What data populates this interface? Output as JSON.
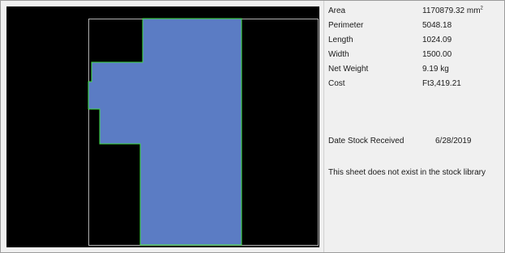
{
  "properties": [
    {
      "label": "Area",
      "value": "1170879.32 mm",
      "sup": "2"
    },
    {
      "label": "Perimeter",
      "value": "5048.18"
    },
    {
      "label": "Length",
      "value": "1024.09"
    },
    {
      "label": "Width",
      "value": "1500.00"
    },
    {
      "label": "Net Weight",
      "value": "9.19 kg"
    },
    {
      "label": "Cost",
      "value": "Ft3,419.21"
    }
  ],
  "stock": {
    "date_label": "Date Stock Received",
    "date_value": "6/28/2019",
    "note": "This sheet does not exist in the stock library"
  },
  "colors": {
    "viewport_bg": "#000000",
    "part_fill": "#5b7cc4",
    "part_outline": "#3ddc3d",
    "sheet_outline": "#b0b0b0"
  }
}
